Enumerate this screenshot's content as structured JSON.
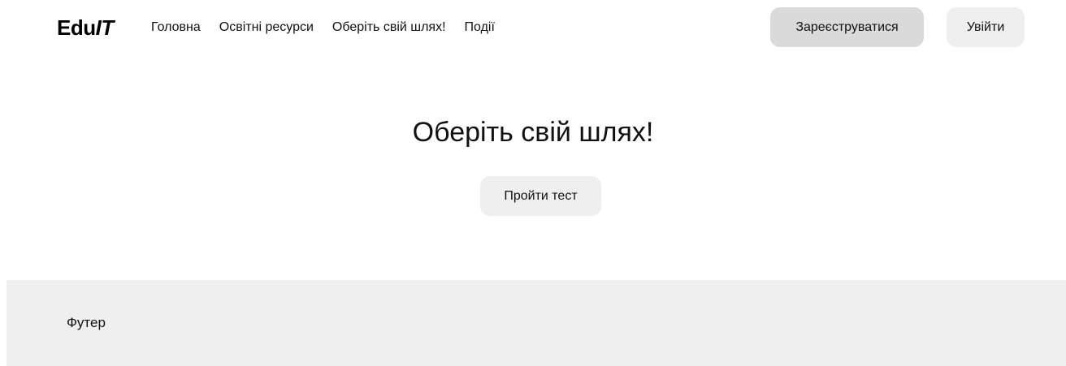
{
  "header": {
    "logo_main": "Edu",
    "logo_italic": "IT",
    "nav": [
      {
        "label": "Головна"
      },
      {
        "label": "Освітні ресурси"
      },
      {
        "label": "Оберіть свій шлях!"
      },
      {
        "label": "Події"
      }
    ],
    "register_label": "Зареєструватися",
    "login_label": "Увійти"
  },
  "hero": {
    "title": "Оберіть свій шлях!",
    "button_label": "Пройти тест"
  },
  "footer": {
    "text": "Футер"
  },
  "colors": {
    "register_button_bg": "#dadada",
    "secondary_button_bg": "#efefef",
    "footer_bg": "#efefef"
  }
}
